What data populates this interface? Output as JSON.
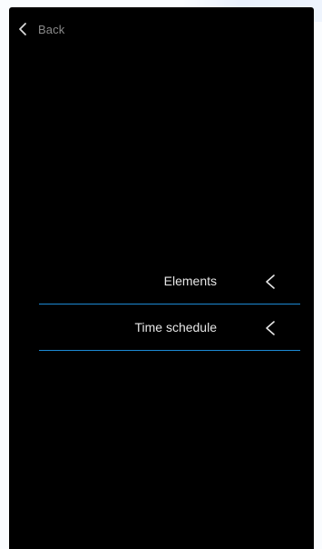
{
  "header": {
    "back_label": "Back",
    "back_icon": "chevron-left-icon"
  },
  "menu": {
    "items": [
      {
        "label": "Elements",
        "icon": "chevron-left-icon"
      },
      {
        "label": "Time schedule",
        "icon": "chevron-left-icon"
      }
    ]
  },
  "colors": {
    "background": "#000000",
    "accent_line": "#1c8ad4",
    "text": "#e6e6e6",
    "muted_text": "#8a8a8a"
  }
}
